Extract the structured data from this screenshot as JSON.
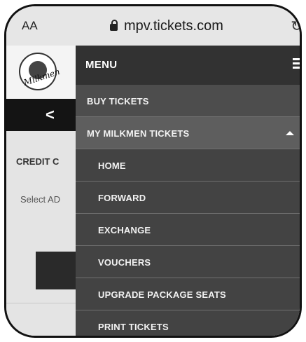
{
  "browser": {
    "aa_label": "AA",
    "url": "mpv.tickets.com"
  },
  "background_page": {
    "logo_script": "Milkmen",
    "back_chevron": "<",
    "credit_label": "CREDIT C",
    "select_label": "Select AD"
  },
  "menu": {
    "title": "MENU",
    "items": [
      {
        "label": "BUY TICKETS"
      },
      {
        "label": "MY MILKMEN TICKETS"
      }
    ],
    "subitems": [
      {
        "label": "HOME"
      },
      {
        "label": "FORWARD"
      },
      {
        "label": "EXCHANGE"
      },
      {
        "label": "VOUCHERS"
      },
      {
        "label": "UPGRADE PACKAGE SEATS"
      },
      {
        "label": "PRINT TICKETS"
      }
    ]
  },
  "colors": {
    "menu_header": "#323232",
    "menu_bg": "#4d4d4d",
    "menu_active": "#5e5e5e",
    "submenu_bg": "#434343"
  }
}
